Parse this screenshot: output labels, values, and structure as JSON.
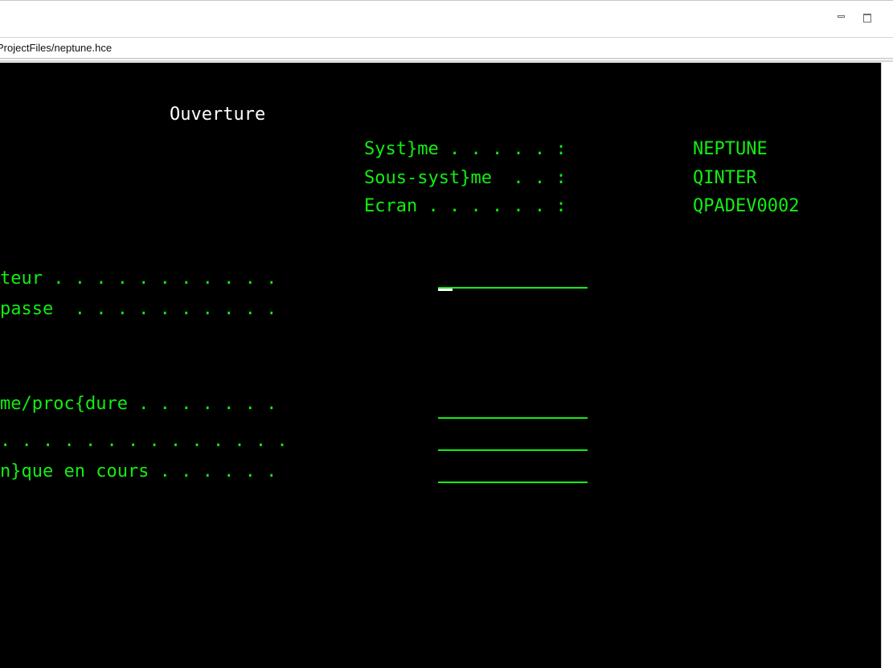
{
  "window": {
    "path": "ProjectFiles/neptune.hce",
    "minimize_icon": "minimize-icon",
    "maximize_icon": "maximize-icon"
  },
  "screen": {
    "title": "Ouverture",
    "info": [
      {
        "label": "Syst}me . . . . . :",
        "value": "NEPTUNE"
      },
      {
        "label": "Sous-syst}me  . . :",
        "value": "QINTER"
      },
      {
        "label": "Ecran . . . . . . :",
        "value": "QPADEV0002"
      }
    ],
    "fields": [
      {
        "label": "teur . . . . . . . . . . ."
      },
      {
        "label": "passe  . . . . . . . . . ."
      },
      {
        "label": "me/proc{dure . . . . . . ."
      },
      {
        "label": ". . . . . . . . . . . . . ."
      },
      {
        "label": "n}que en cours . . . . . ."
      }
    ],
    "colors": {
      "text_green": "#12ee12",
      "text_white": "#ffffff",
      "background": "#000000"
    }
  }
}
